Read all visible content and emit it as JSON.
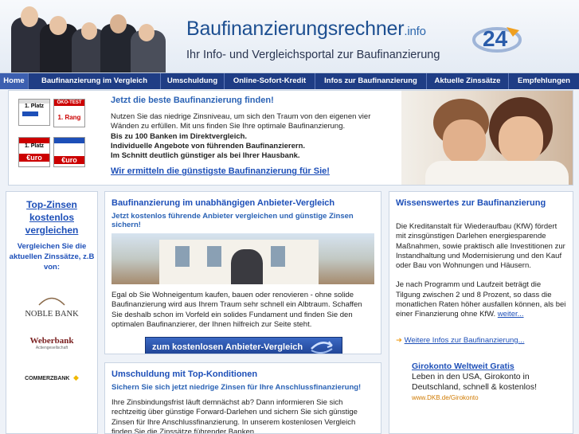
{
  "header": {
    "title": "Baufinanzierungsrechner",
    "tld": ".info",
    "subtitle": "Ihr Info- und Vergleichsportal zur Baufinanzierung",
    "logo_text": "24"
  },
  "nav": {
    "items": [
      {
        "label": "Home"
      },
      {
        "label": "Baufinanzierung im Vergleich"
      },
      {
        "label": "Umschuldung"
      },
      {
        "label": "Online-Sofort-Kredit"
      },
      {
        "label": "Infos zur Baufinanzierung"
      },
      {
        "label": "Aktuelle Zinssätze"
      },
      {
        "label": "Empfehlungen"
      }
    ]
  },
  "banner": {
    "headline": "Jetzt die beste Baufinanzierung finden!",
    "line1": "Nutzen Sie das niedrige Zinsniveau, um sich den Traum von den eigenen vier Wänden zu erfüllen. Mit uns finden Sie Ihre optimale Baufinanzierung.",
    "bold1": "Bis zu 100 Banken im Direktvergleich.",
    "bold2": "Individuelle Angebote von führenden Baufinanzierern.",
    "bold3": "Im Schnitt deutlich günstiger als bei Ihrer Hausbank.",
    "link": "Wir ermitteln die günstigste Baufinanzierung für Sie!",
    "badges": {
      "b1_title": "1. Platz",
      "b2_title": "ÖKO-TEST",
      "b2_rank": "1. Rang",
      "b3_title": "1. Platz",
      "b3_brand": "€uro",
      "b4_brand": "€uro"
    }
  },
  "left": {
    "title": "Top-Zinsen kostenlos vergleichen",
    "subtitle": "Vergleichen Sie die aktuellen Zinssätze, z.B von:",
    "banks": [
      "NOBLE BANK",
      "Weberbank",
      "COMMERZBANK"
    ],
    "weberbank_sub": "Actiengesellschaft"
  },
  "middle": {
    "title": "Baufinanzierung im unabhängigen Anbieter-Vergleich",
    "subtitle": "Jetzt kostenlos führende Anbieter vergleichen und günstige Zinsen sichern!",
    "body": "Egal ob Sie Wohneigentum kaufen, bauen oder renovieren - ohne solide Baufinanzierung wird aus Ihrem Traum sehr schnell ein Albtraum. Schaffen Sie deshalb schon im Vorfeld ein solides Fundament und finden Sie den optimalen Baufinanzierer, der Ihnen hilfreich zur Seite steht.",
    "cta": "zum kostenlosen Anbieter-Vergleich"
  },
  "middle2": {
    "title": "Umschuldung mit Top-Konditionen",
    "subtitle": "Sichern Sie sich jetzt niedrige Zinsen für Ihre Anschlussfinanzierung!",
    "body": "Ihre Zinsbindungsfrist läuft demnächst ab? Dann informieren Sie sich rechtzeitig über günstige Forward-Darlehen und sichern Sie sich günstige Zinsen für Ihre Anschlussfinanzierung. In unserem kostenlosen Vergleich finden Sie die Zinssätze führender Banken."
  },
  "right": {
    "title": "Wissenswertes zur Baufinanzierung",
    "p1": "Die Kreditanstalt für Wiederaufbau (KfW) fördert mit zinsgünstigen Darlehen energiesparende Maßnahmen, sowie praktisch alle Investitionen zur Instandhaltung und Modernisierung und den Kauf oder Bau von Wohnungen und Häusern.",
    "p2": "Je nach Programm und Laufzeit beträgt die Tilgung zwischen 2 und 8 Prozent, so dass die monatlichen Raten höher ausfallen können, als bei einer Finanzierung ohne KfW.",
    "more": "weiter...",
    "more_link": "Weitere Infos zur Baufinanzierung...",
    "ad_title": "Girokonto Weltweit Gratis",
    "ad_body": "Leben in den USA, Girokonto in Deutschland, schnell & kostenlos!",
    "ad_url": "www.DKB.de/Girokonto"
  }
}
